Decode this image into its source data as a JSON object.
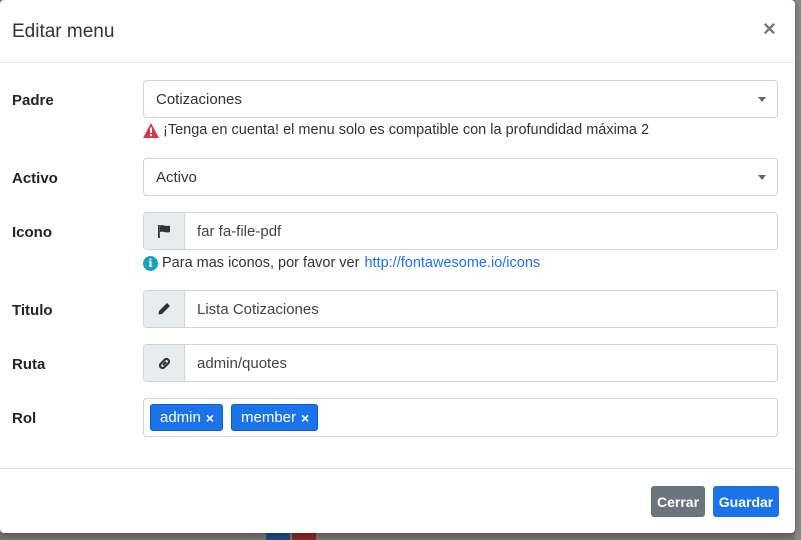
{
  "modal": {
    "title": "Editar menu",
    "close_glyph": "×"
  },
  "fields": {
    "padre": {
      "label": "Padre",
      "value": "Cotizaciones"
    },
    "warning": "¡Tenga en cuenta! el menu solo es compatible con la profundidad máxima 2",
    "activo": {
      "label": "Activo",
      "value": "Activo"
    },
    "icono": {
      "label": "Icono",
      "value": "far fa-file-pdf",
      "icon": "flag-icon"
    },
    "icon_hint": {
      "text": "Para mas iconos, por favor ver",
      "link": "http://fontawesome.io/icons"
    },
    "titulo": {
      "label": "Titulo",
      "value": "Lista Cotizaciones",
      "icon": "pencil-icon"
    },
    "ruta": {
      "label": "Ruta",
      "value": "admin/quotes",
      "icon": "link-icon"
    },
    "rol": {
      "label": "Rol",
      "tags": [
        "admin",
        "member"
      ],
      "remove_glyph": "×"
    }
  },
  "footer": {
    "close_label": "Cerrar",
    "save_label": "Guardar"
  },
  "colors": {
    "primary": "#1a73e8",
    "secondary": "#6c757d",
    "warning": "#dc3545",
    "info": "#17a2b8"
  }
}
